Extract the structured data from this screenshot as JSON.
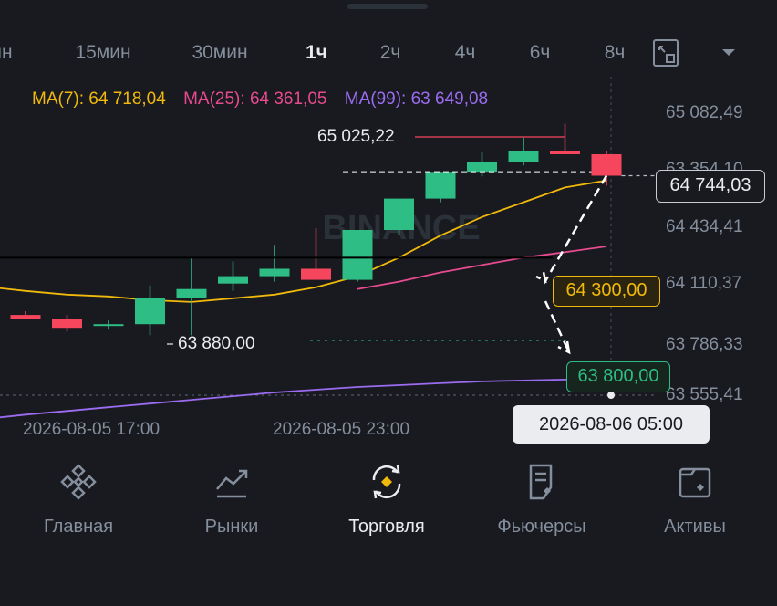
{
  "timeframes": {
    "items": [
      "нн",
      "15мин",
      "30мин",
      "1ч",
      "2ч",
      "4ч",
      "6ч",
      "8ч"
    ],
    "active_label": "1ч"
  },
  "indicators": {
    "ma7": {
      "label": "MA(7): 64 718,04",
      "color": "#f0b90b"
    },
    "ma25": {
      "label": "MA(25): 64 361,05",
      "color": "#e84a8f"
    },
    "ma99": {
      "label": "MA(99): 63 649,08",
      "color": "#9b6cf0"
    }
  },
  "watermark": "BINANCE",
  "price_axis": {
    "ticks": [
      "65 082,49",
      "63 354,10",
      "64 434,41",
      "64 110,37",
      "63 786,33",
      "63 555,41"
    ]
  },
  "time_axis": {
    "labels": [
      "2026-08-05 17:00",
      "2026-08-05 23:00"
    ]
  },
  "chart": {
    "current_price": "64 744,03",
    "high_label": "65 025,22",
    "low_label": "63 880,00",
    "order_yellow": "64 300,00",
    "order_green": "63 800,00",
    "crosshair_time": "2026-08-06 05:00"
  },
  "colors": {
    "up": "#2ebd85",
    "down": "#f6465d",
    "ma7": "#f0b90b",
    "ma25": "#e84a8f",
    "ma99": "#9b6cf0",
    "background": "#181a20",
    "muted": "#848e9c"
  },
  "chart_data": {
    "type": "candlestick",
    "interval": "1ч",
    "candles": [
      {
        "o": 63990,
        "h": 64010,
        "l": 63980,
        "c": 63970
      },
      {
        "o": 63970,
        "h": 63990,
        "l": 63900,
        "c": 63920
      },
      {
        "o": 63930,
        "h": 63960,
        "l": 63910,
        "c": 63940
      },
      {
        "o": 63940,
        "h": 64150,
        "l": 63880,
        "c": 64080
      },
      {
        "o": 64080,
        "h": 64300,
        "l": 63880,
        "c": 64130
      },
      {
        "o": 64160,
        "h": 64280,
        "l": 64120,
        "c": 64200
      },
      {
        "o": 64200,
        "h": 64370,
        "l": 64170,
        "c": 64240
      },
      {
        "o": 64240,
        "h": 64460,
        "l": 64190,
        "c": 64180
      },
      {
        "o": 64180,
        "h": 64440,
        "l": 64170,
        "c": 64450
      },
      {
        "o": 64450,
        "h": 64610,
        "l": 64420,
        "c": 64620
      },
      {
        "o": 64620,
        "h": 64760,
        "l": 64600,
        "c": 64760
      },
      {
        "o": 64760,
        "h": 64870,
        "l": 64740,
        "c": 64820
      },
      {
        "o": 64820,
        "h": 64950,
        "l": 64800,
        "c": 64880
      },
      {
        "o": 64880,
        "h": 65025.22,
        "l": 64860,
        "c": 64860
      },
      {
        "o": 64860,
        "h": 64880,
        "l": 64690,
        "c": 64744.03
      }
    ],
    "ma7": [
      64120,
      64100,
      64090,
      64070,
      64060,
      64080,
      64100,
      64140,
      64200,
      64300,
      64420,
      64520,
      64600,
      64680,
      64718.04
    ],
    "ma25": [
      null,
      null,
      null,
      null,
      null,
      null,
      null,
      null,
      64130,
      64170,
      64220,
      64260,
      64300,
      64330,
      64361.05
    ],
    "ma99": [
      63450,
      63470,
      63490,
      63510,
      63530,
      63550,
      63570,
      63585,
      63600,
      63610,
      63620,
      63630,
      63635,
      63640,
      63649.08
    ],
    "projection": {
      "from": 64744.03,
      "targets": [
        64300,
        63800
      ]
    },
    "ylim": [
      63450,
      65150
    ]
  },
  "nav": {
    "items": [
      {
        "label": "Главная",
        "icon": "binance-logo-icon",
        "active": false
      },
      {
        "label": "Рынки",
        "icon": "market-chart-icon",
        "active": false
      },
      {
        "label": "Торговля",
        "icon": "trade-swap-icon",
        "active": true
      },
      {
        "label": "Фьючерсы",
        "icon": "futures-document-icon",
        "active": false
      },
      {
        "label": "Активы",
        "icon": "wallet-icon",
        "active": false
      }
    ]
  }
}
